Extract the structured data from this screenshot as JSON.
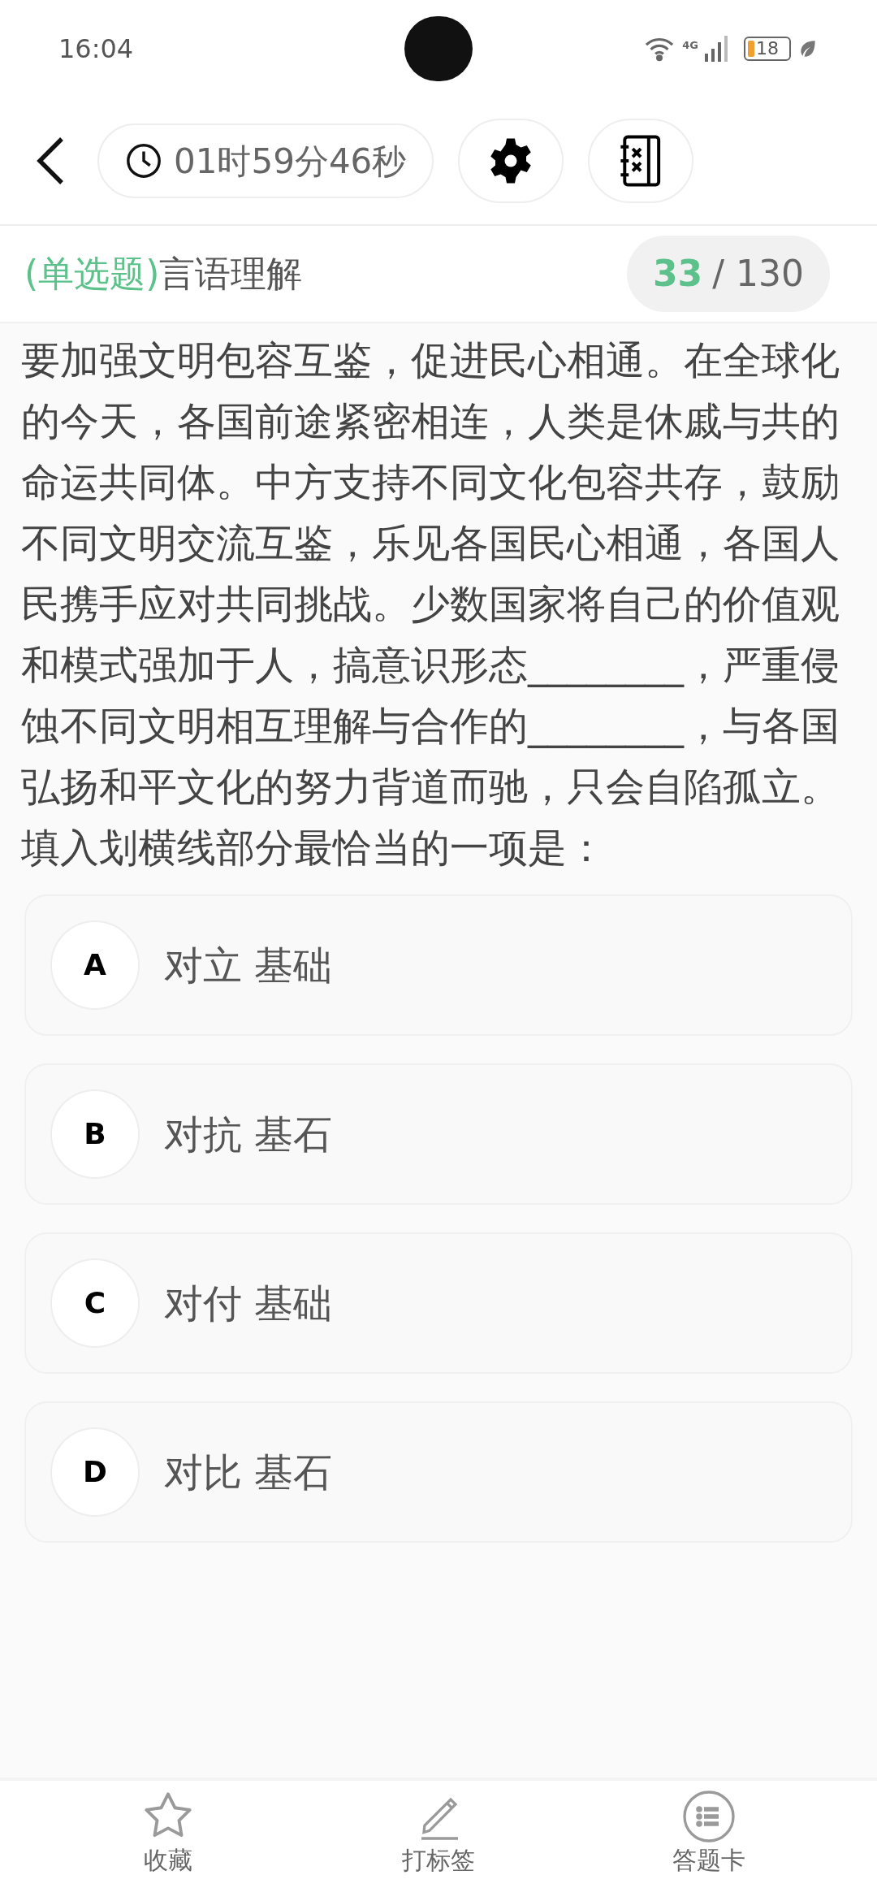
{
  "status_bar": {
    "time": "16:04",
    "network": "4G",
    "battery": "18"
  },
  "header": {
    "timer": "01时59分46秒"
  },
  "question_header": {
    "type": "(单选题)",
    "category": "言语理解",
    "current": "33",
    "total": "/ 130"
  },
  "question": {
    "text": "要加强文明包容互鉴，促进民心相通。在全球化的今天，各国前途紧密相连，人类是休戚与共的命运共同体。中方支持不同文化包容共存，鼓励不同文明交流互鉴，乐见各国民心相通，各国人民携手应对共同挑战。少数国家将自己的价值观和模式强加于人，搞意识形态________，严重侵蚀不同文明相互理解与合作的________，与各国弘扬和平文化的努力背道而驰，只会自陷孤立。",
    "prompt": "填入划横线部分最恰当的一项是："
  },
  "options": [
    {
      "letter": "A",
      "text": "对立 基础",
      "selected": false
    },
    {
      "letter": "B",
      "text": "对抗 基石",
      "selected": false
    },
    {
      "letter": "C",
      "text": "对付 基础",
      "selected": false
    },
    {
      "letter": "D",
      "text": "对比 基石",
      "selected": false
    }
  ],
  "bottom_bar": [
    {
      "kind": "star",
      "label": "收藏"
    },
    {
      "kind": "pencil",
      "label": "打标签"
    },
    {
      "kind": "list",
      "label": "答题卡"
    }
  ]
}
